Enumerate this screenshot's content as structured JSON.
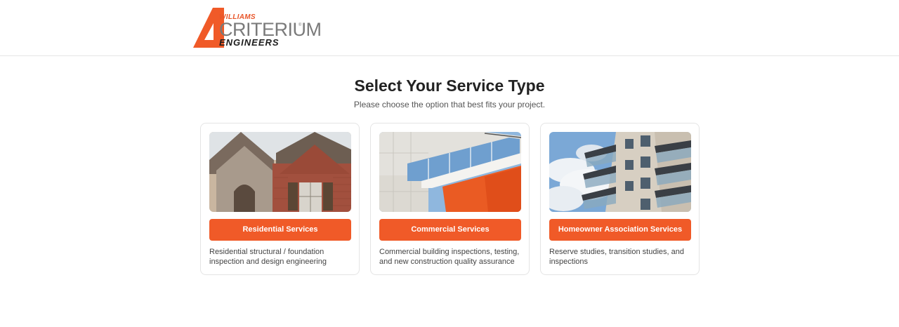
{
  "logo": {
    "top_text": "WILLIAMS",
    "main_text": "CRITERIUM",
    "registered": "®",
    "bottom_text": "ENGINEERS",
    "colors": {
      "orange": "#f05a28",
      "gray": "#7a7a7a",
      "dark": "#1d1d1d"
    }
  },
  "page": {
    "title": "Select Your Service Type",
    "subtitle": "Please choose the option that best fits your project."
  },
  "accent_color": "#f05a28",
  "cards": [
    {
      "image": "brick-house-photo",
      "button_label": "Residential Services",
      "description": "Residential structural / foundation inspection and design engineering"
    },
    {
      "image": "commercial-building-photo",
      "button_label": "Commercial Services",
      "description": "Commercial building inspections, testing, and new construction quality assurance"
    },
    {
      "image": "apartment-balconies-photo",
      "button_label": "Homeowner Association Services",
      "description": "Reserve studies, transition studies, and inspections"
    }
  ]
}
